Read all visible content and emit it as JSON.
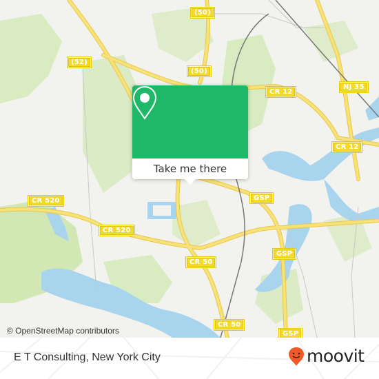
{
  "map": {
    "attribution": "© OpenStreetMap contributors",
    "colors": {
      "land": "#f2f2ee",
      "park": "#d2e8b4",
      "water": "#a9d4ee",
      "road": "#f7e27a",
      "road_edge": "#e8c94a",
      "rail": "#777777",
      "shield": "#f2d92b"
    },
    "road_labels": [
      {
        "id": "r50-top",
        "text": "(50)"
      },
      {
        "id": "r52",
        "text": "(52)"
      },
      {
        "id": "r50-mid",
        "text": "(50)"
      },
      {
        "id": "cr12-a",
        "text": "CR 12"
      },
      {
        "id": "nj35",
        "text": "NJ 35"
      },
      {
        "id": "cr12-b",
        "text": "CR 12"
      },
      {
        "id": "cr520-a",
        "text": "CR 520"
      },
      {
        "id": "cr520-b",
        "text": "CR 520"
      },
      {
        "id": "gsp-a",
        "text": "GSP"
      },
      {
        "id": "gsp-b",
        "text": "GSP"
      },
      {
        "id": "cr50-a",
        "text": "CR 50"
      },
      {
        "id": "cr50-b",
        "text": "CR 50"
      },
      {
        "id": "gsp-c",
        "text": "GSP"
      }
    ]
  },
  "popup": {
    "icon": "map-pin-icon",
    "button_label": "Take me there",
    "accent": "#1eb868"
  },
  "footer": {
    "place_title": "E T Consulting, New York City",
    "brand": "moovit",
    "brand_color": "#f05a28"
  }
}
